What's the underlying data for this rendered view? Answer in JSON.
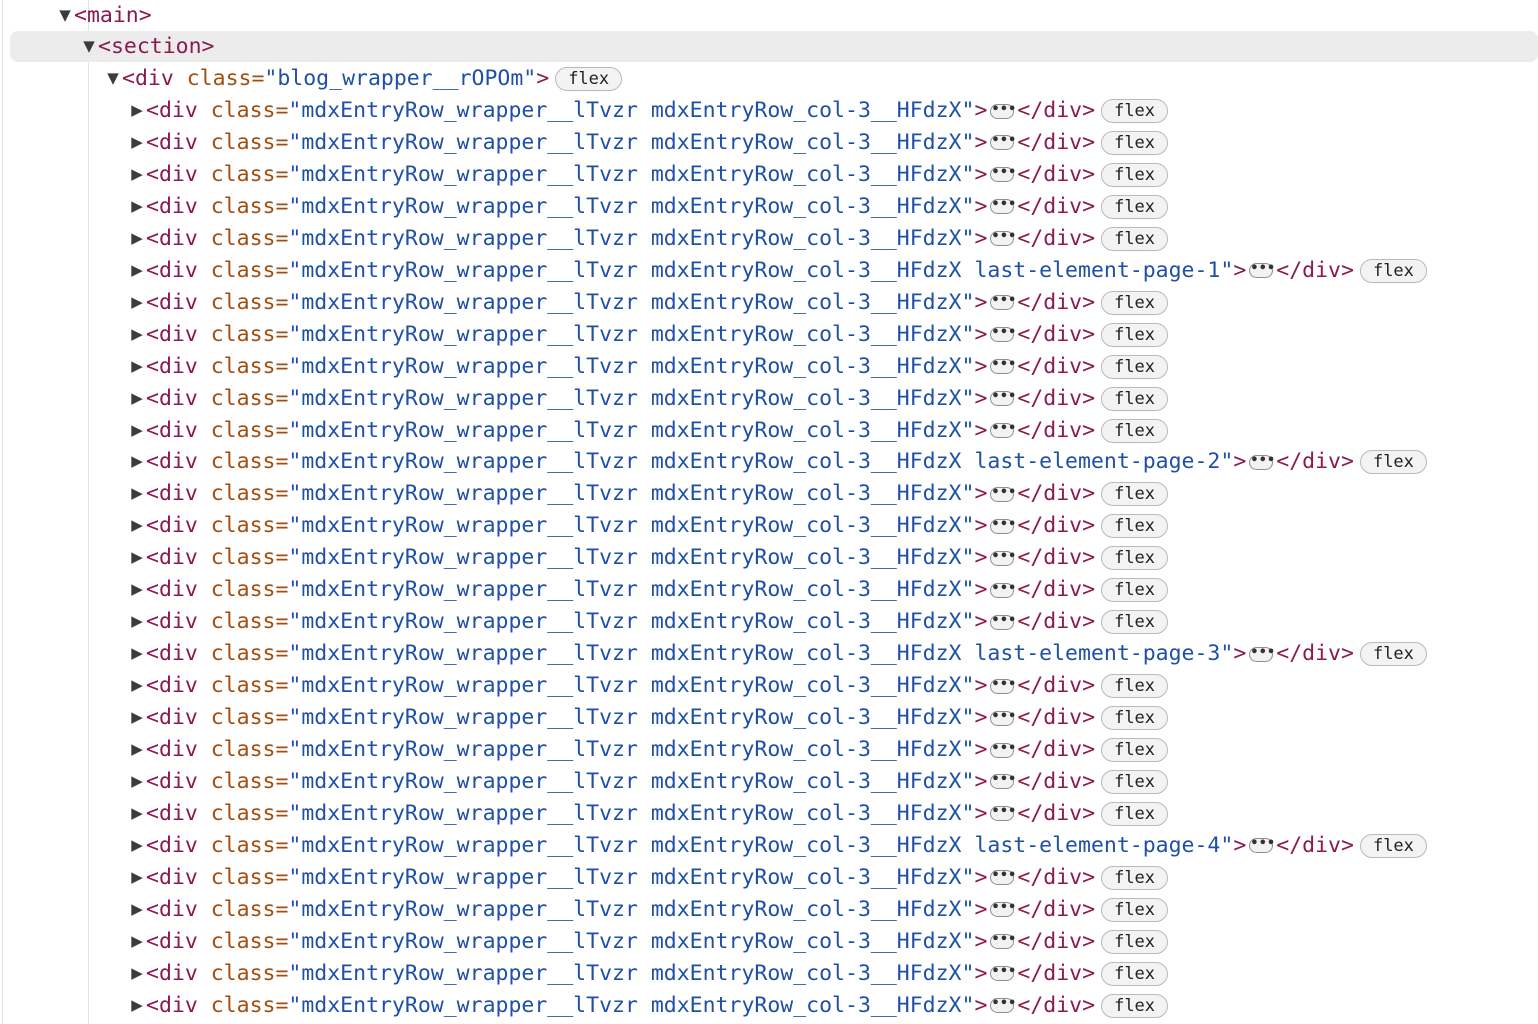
{
  "tree": {
    "main_tag": "<main>",
    "section_tag": "<section>",
    "wrapper": {
      "open": "<div",
      "attr": "class=",
      "value": "\"blog_wrapper__rOPOm\"",
      "close": ">",
      "badge": "flex"
    },
    "ellipsis": "•••",
    "rows": [
      {
        "value": "\"mdxEntryRow_wrapper__lTvzr mdxEntryRow_col-3__HFdzX\"",
        "badge": "flex"
      },
      {
        "value": "\"mdxEntryRow_wrapper__lTvzr mdxEntryRow_col-3__HFdzX\"",
        "badge": "flex"
      },
      {
        "value": "\"mdxEntryRow_wrapper__lTvzr mdxEntryRow_col-3__HFdzX\"",
        "badge": "flex"
      },
      {
        "value": "\"mdxEntryRow_wrapper__lTvzr mdxEntryRow_col-3__HFdzX\"",
        "badge": "flex"
      },
      {
        "value": "\"mdxEntryRow_wrapper__lTvzr mdxEntryRow_col-3__HFdzX\"",
        "badge": "flex"
      },
      {
        "value": "\"mdxEntryRow_wrapper__lTvzr mdxEntryRow_col-3__HFdzX last-element-page-1\"",
        "badge": "flex"
      },
      {
        "value": "\"mdxEntryRow_wrapper__lTvzr mdxEntryRow_col-3__HFdzX\"",
        "badge": "flex"
      },
      {
        "value": "\"mdxEntryRow_wrapper__lTvzr mdxEntryRow_col-3__HFdzX\"",
        "badge": "flex"
      },
      {
        "value": "\"mdxEntryRow_wrapper__lTvzr mdxEntryRow_col-3__HFdzX\"",
        "badge": "flex"
      },
      {
        "value": "\"mdxEntryRow_wrapper__lTvzr mdxEntryRow_col-3__HFdzX\"",
        "badge": "flex"
      },
      {
        "value": "\"mdxEntryRow_wrapper__lTvzr mdxEntryRow_col-3__HFdzX\"",
        "badge": "flex"
      },
      {
        "value": "\"mdxEntryRow_wrapper__lTvzr mdxEntryRow_col-3__HFdzX last-element-page-2\"",
        "badge": "flex"
      },
      {
        "value": "\"mdxEntryRow_wrapper__lTvzr mdxEntryRow_col-3__HFdzX\"",
        "badge": "flex"
      },
      {
        "value": "\"mdxEntryRow_wrapper__lTvzr mdxEntryRow_col-3__HFdzX\"",
        "badge": "flex"
      },
      {
        "value": "\"mdxEntryRow_wrapper__lTvzr mdxEntryRow_col-3__HFdzX\"",
        "badge": "flex"
      },
      {
        "value": "\"mdxEntryRow_wrapper__lTvzr mdxEntryRow_col-3__HFdzX\"",
        "badge": "flex"
      },
      {
        "value": "\"mdxEntryRow_wrapper__lTvzr mdxEntryRow_col-3__HFdzX\"",
        "badge": "flex"
      },
      {
        "value": "\"mdxEntryRow_wrapper__lTvzr mdxEntryRow_col-3__HFdzX last-element-page-3\"",
        "badge": "flex"
      },
      {
        "value": "\"mdxEntryRow_wrapper__lTvzr mdxEntryRow_col-3__HFdzX\"",
        "badge": "flex"
      },
      {
        "value": "\"mdxEntryRow_wrapper__lTvzr mdxEntryRow_col-3__HFdzX\"",
        "badge": "flex"
      },
      {
        "value": "\"mdxEntryRow_wrapper__lTvzr mdxEntryRow_col-3__HFdzX\"",
        "badge": "flex"
      },
      {
        "value": "\"mdxEntryRow_wrapper__lTvzr mdxEntryRow_col-3__HFdzX\"",
        "badge": "flex"
      },
      {
        "value": "\"mdxEntryRow_wrapper__lTvzr mdxEntryRow_col-3__HFdzX\"",
        "badge": "flex"
      },
      {
        "value": "\"mdxEntryRow_wrapper__lTvzr mdxEntryRow_col-3__HFdzX last-element-page-4\"",
        "badge": "flex"
      },
      {
        "value": "\"mdxEntryRow_wrapper__lTvzr mdxEntryRow_col-3__HFdzX\"",
        "badge": "flex"
      },
      {
        "value": "\"mdxEntryRow_wrapper__lTvzr mdxEntryRow_col-3__HFdzX\"",
        "badge": "flex"
      },
      {
        "value": "\"mdxEntryRow_wrapper__lTvzr mdxEntryRow_col-3__HFdzX\"",
        "badge": "flex"
      },
      {
        "value": "\"mdxEntryRow_wrapper__lTvzr mdxEntryRow_col-3__HFdzX\"",
        "badge": "flex"
      },
      {
        "value": "\"mdxEntryRow_wrapper__lTvzr mdxEntryRow_col-3__HFdzX\"",
        "badge": "flex"
      }
    ],
    "row_open": "<div",
    "row_attr": "class=",
    "row_close": ">",
    "row_end": "</div>"
  },
  "colors": {
    "tag": "#8a1a4f",
    "attribute": "#a34d0f",
    "value": "#1f4fa8",
    "selected_background": "#ececec"
  },
  "icons": {
    "expanded": "disclosure-triangle-down",
    "collapsed": "disclosure-triangle-right",
    "ellipsis": "collapsed-content-ellipsis"
  }
}
